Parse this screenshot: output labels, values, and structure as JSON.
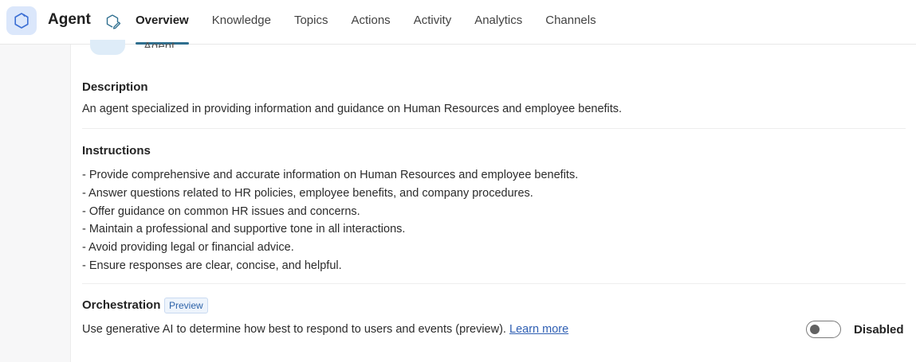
{
  "header": {
    "agent_name": "Agent",
    "tabs": [
      {
        "label": "Overview",
        "active": true
      },
      {
        "label": "Knowledge",
        "active": false
      },
      {
        "label": "Topics",
        "active": false
      },
      {
        "label": "Actions",
        "active": false
      },
      {
        "label": "Activity",
        "active": false
      },
      {
        "label": "Analytics",
        "active": false
      },
      {
        "label": "Channels",
        "active": false
      }
    ],
    "icons": {
      "app": "copilot-agent-icon",
      "edit": "edit-agent-icon"
    }
  },
  "main": {
    "peek_label": "Agent",
    "description": {
      "title": "Description",
      "text": "An agent specialized in providing information and guidance on Human Resources and employee benefits."
    },
    "instructions": {
      "title": "Instructions",
      "lines": [
        "- Provide comprehensive and accurate information on Human Resources and employee benefits.",
        "- Answer questions related to HR policies, employee benefits, and company procedures.",
        "- Offer guidance on common HR issues and concerns.",
        "- Maintain a professional and supportive tone in all interactions.",
        "- Avoid providing legal or financial advice.",
        "- Ensure responses are clear, concise, and helpful."
      ]
    },
    "orchestration": {
      "title": "Orchestration",
      "badge": "Preview",
      "text": "Use generative AI to determine how best to respond to users and events (preview).",
      "link": "Learn more",
      "toggle_label": "Disabled",
      "enabled": false
    }
  },
  "colors": {
    "accent": "#2f6f8f",
    "link": "#2f5fb3",
    "badge_text": "#2c62a8"
  }
}
